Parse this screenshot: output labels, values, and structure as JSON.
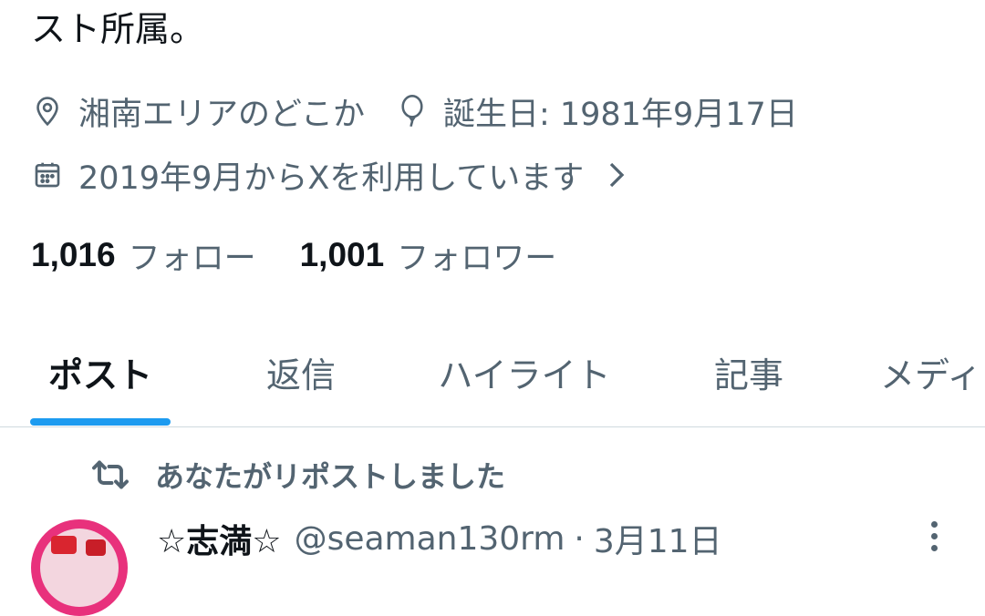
{
  "profile": {
    "bio_tail": "スト所属。",
    "location": "湘南エリアのどこか",
    "birthday": "誕生日: 1981年9月17日",
    "joined": "2019年9月からXを利用しています",
    "following_count": "1,016",
    "following_label": "フォロー",
    "followers_count": "1,001",
    "followers_label": "フォロワー"
  },
  "tabs": [
    {
      "label": "ポスト",
      "active": true
    },
    {
      "label": "返信",
      "active": false
    },
    {
      "label": "ハイライト",
      "active": false
    },
    {
      "label": "記事",
      "active": false
    },
    {
      "label": "メディア",
      "active": false
    }
  ],
  "feed": {
    "repost_label": "あなたがリポストしました",
    "post": {
      "display_name": "☆志満☆",
      "handle": "@seaman130rm",
      "separator": "·",
      "date": "3月11日"
    }
  },
  "icons": {
    "location": "location-pin-icon",
    "birthday": "balloon-icon",
    "joined": "calendar-icon",
    "chevron": "chevron-right-icon",
    "repost": "repost-icon",
    "more": "more-vertical-icon"
  },
  "colors": {
    "text_primary": "#0f1419",
    "text_secondary": "#536471",
    "accent": "#1d9bf0",
    "divider": "#cfd9de"
  }
}
